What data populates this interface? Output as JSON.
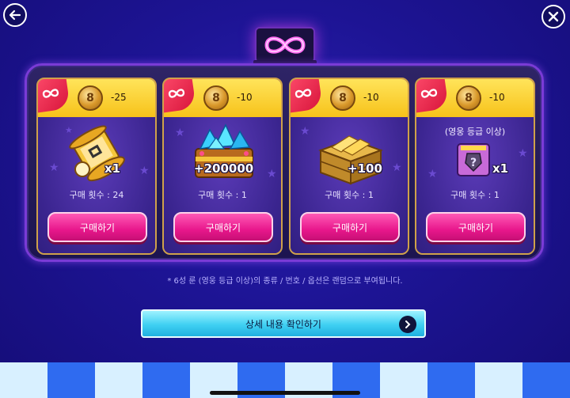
{
  "header": {
    "back_icon": "back-arrow-icon",
    "close_icon": "close-icon",
    "sign_icon": "infinity-icon"
  },
  "products": [
    {
      "coin_label": "8",
      "cost": "-25",
      "note": "",
      "item": "scroll",
      "quantity": "x1",
      "purchase_count": "구매 횟수 : 24",
      "buy_label": "구매하기"
    },
    {
      "coin_label": "8",
      "cost": "-10",
      "note": "",
      "item": "crystal-chest",
      "quantity": "+200000",
      "purchase_count": "구매 횟수 : 1",
      "buy_label": "구매하기"
    },
    {
      "coin_label": "8",
      "cost": "-10",
      "note": "",
      "item": "gold-crate",
      "quantity": "+100",
      "purchase_count": "구매 횟수 : 1",
      "buy_label": "구매하기"
    },
    {
      "coin_label": "8",
      "cost": "-10",
      "note": "(영웅 등급 이상)",
      "item": "random-rune",
      "quantity": "x1",
      "purchase_count": "구매 횟수 : 1",
      "buy_label": "구매하기"
    }
  ],
  "footnote": "* 6성 룬 (영웅 등급 이상)의 종류 / 번호 / 옵션은 랜덤으로 부여됩니다.",
  "detail_button": {
    "label": "상세 내용 확인하기"
  },
  "colors": {
    "background": "#1d1494",
    "panel_border": "#7a3bd6",
    "card_header": "#f7c21a",
    "buy_button": "#e8178c",
    "detail_button": "#3fd0f2",
    "awning_light": "#d8f0ff",
    "awning_dark": "#2f6bf0"
  }
}
